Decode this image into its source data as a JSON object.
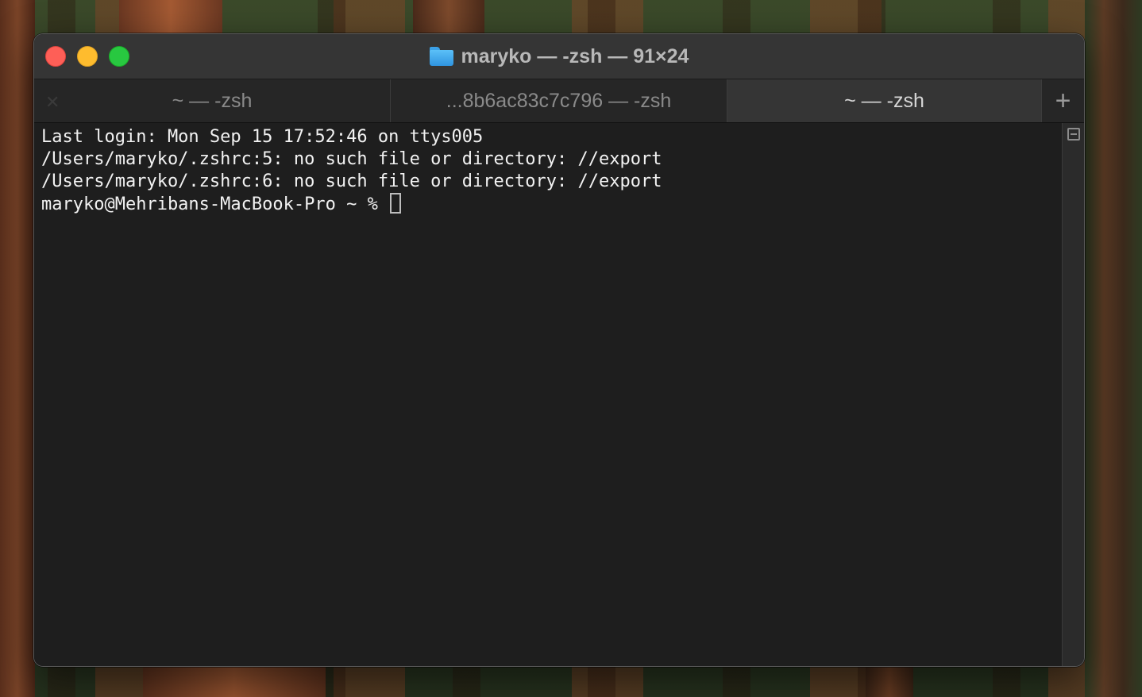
{
  "window": {
    "title": "maryko — -zsh — 91×24",
    "title_icon": "folder-icon"
  },
  "tabs": [
    {
      "label": "~ — -zsh",
      "active": false
    },
    {
      "label": "...8b6ac83c7c796 — -zsh",
      "active": false
    },
    {
      "label": "~ — -zsh",
      "active": true
    }
  ],
  "tab_close_glyph": "✕",
  "new_tab_glyph": "+",
  "terminal": {
    "lines": [
      "Last login: Mon Sep 15 17:52:46 on ttys005",
      "/Users/maryko/.zshrc:5: no such file or directory: //export",
      "/Users/maryko/.zshrc:6: no such file or directory: //export"
    ],
    "prompt": "maryko@Mehribans-MacBook-Pro ~ % "
  },
  "colors": {
    "close": "#fe5f57",
    "minimize": "#febc2e",
    "maximize": "#28c840",
    "terminal_bg": "#1e1e1e",
    "terminal_fg": "#f2f2f2"
  }
}
